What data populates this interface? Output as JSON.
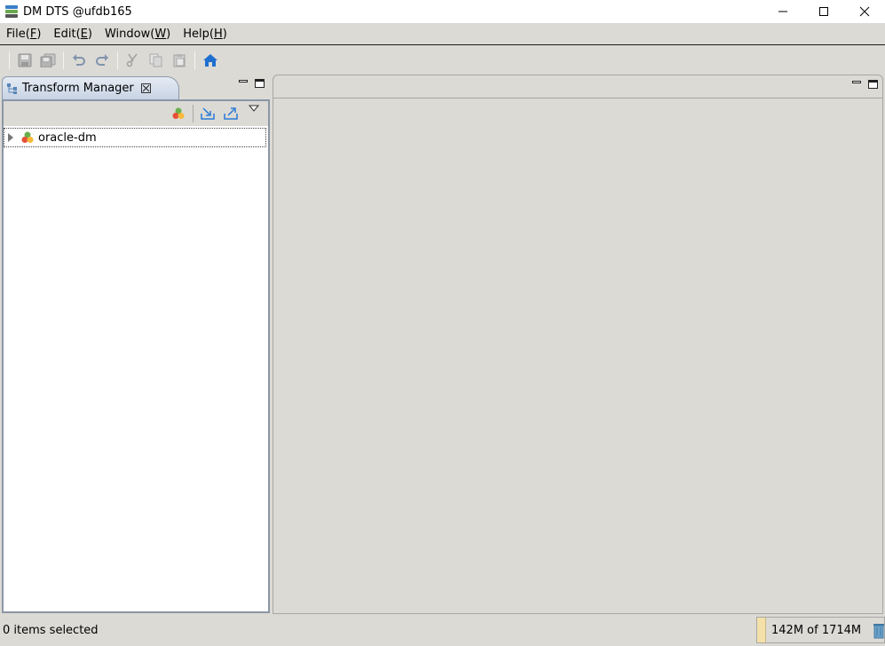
{
  "window": {
    "title": "DM DTS @ufdb165"
  },
  "menubar": {
    "items": [
      {
        "label": "File",
        "mnemonic": "F"
      },
      {
        "label": "Edit",
        "mnemonic": "E"
      },
      {
        "label": "Window",
        "mnemonic": "W"
      },
      {
        "label": "Help",
        "mnemonic": "H"
      }
    ]
  },
  "toolbar": {
    "icons": [
      "save-icon",
      "save-all-icon",
      "undo-icon",
      "redo-icon",
      "cut-icon",
      "copy-icon",
      "paste-icon",
      "home-icon"
    ]
  },
  "left_view": {
    "tab_label": "Transform Manager",
    "tree": [
      {
        "label": "oracle-dm",
        "icon": "project-icon",
        "expanded": false
      }
    ]
  },
  "status": {
    "selection_text": "0 items selected",
    "heap_text": "142M of 1714M"
  },
  "colors": {
    "accent": "#1e6fd0",
    "tab_gradient_top": "#e6ebf3",
    "tab_gradient_bottom": "#c7d3e4",
    "heap_fill": "#f3e1a9"
  }
}
